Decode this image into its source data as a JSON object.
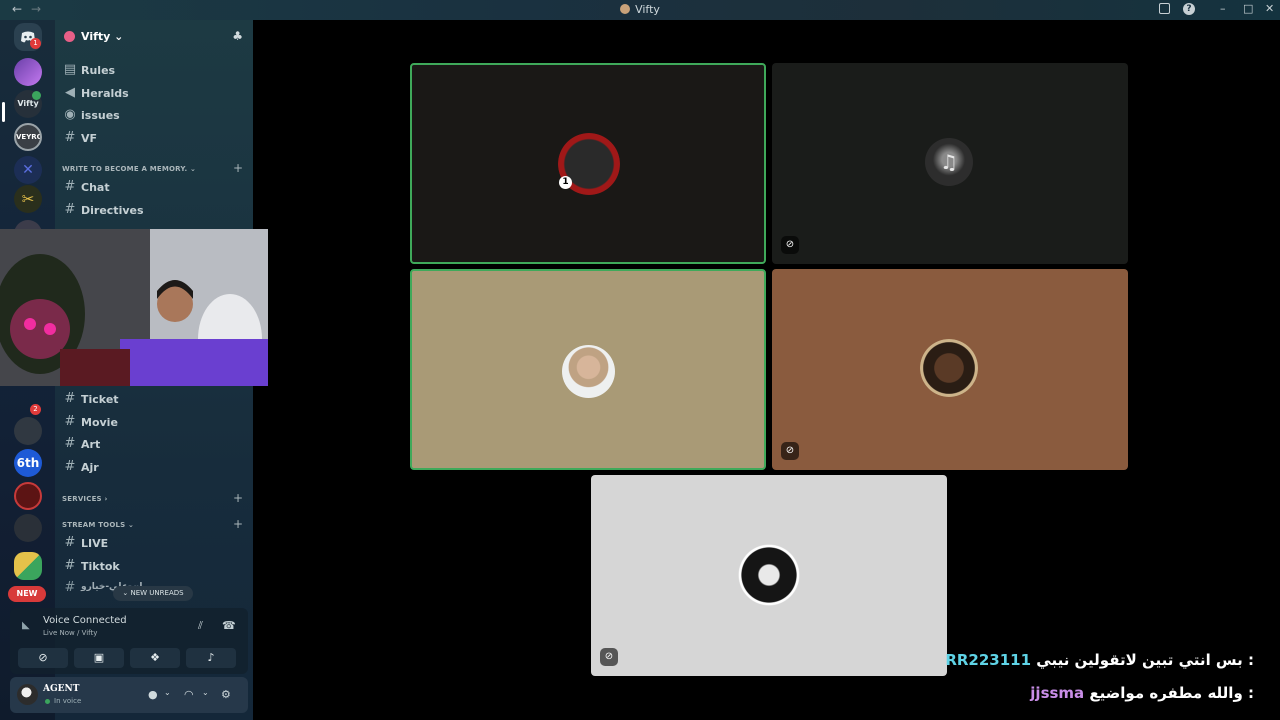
{
  "window": {
    "title": "Vifty",
    "back_glyph": "←",
    "forward_glyph": "→",
    "minimize_glyph": "–",
    "maximize_glyph": "□",
    "close_glyph": "✕",
    "inbox_icon": "inbox-icon",
    "help_glyph": "?"
  },
  "rail": {
    "home_badge": "1",
    "server_badge": "2",
    "new_label": "NEW"
  },
  "guild": {
    "name": "Vifty",
    "chevron": "⌄",
    "add_member_glyph": "♣"
  },
  "channels_top": [
    {
      "name": "Rules",
      "icon": "rules-icon",
      "glyph": "▤"
    },
    {
      "name": "Heralds",
      "icon": "announcement-icon",
      "glyph": "◀"
    },
    {
      "name": "issues",
      "icon": "forum-icon",
      "glyph": "◉"
    },
    {
      "name": "VF",
      "icon": "hash-icon",
      "glyph": "#"
    }
  ],
  "category_memory": {
    "name": "WRITE TO BECOME A MEMORY.",
    "chevron": "⌄",
    "plus": "+"
  },
  "channels_memory": [
    {
      "name": "Chat",
      "glyph": "#"
    },
    {
      "name": "Directives",
      "glyph": "#"
    }
  ],
  "channels_mid": [
    {
      "name": "Ticket",
      "glyph": "#"
    },
    {
      "name": "Movie",
      "glyph": "#"
    },
    {
      "name": "Art",
      "glyph": "#"
    },
    {
      "name": "Ajr",
      "glyph": "#"
    }
  ],
  "category_services": {
    "name": "SERVICES",
    "chevron": "›",
    "plus": "+"
  },
  "category_stream": {
    "name": "STREAM TOOLS",
    "chevron": "⌄",
    "plus": "+"
  },
  "channels_stream": [
    {
      "name": "LIVE",
      "glyph": "#"
    },
    {
      "name": "Tiktok",
      "glyph": "#"
    },
    {
      "name": "بيبان-علي-خيارو",
      "glyph": "#"
    }
  ],
  "new_unreads": "⌄ NEW UNREADS",
  "voice": {
    "title": "Voice Connected",
    "subtitle": "Live Now / Vifty",
    "signal_glyph": "◣",
    "noise_glyph": "⫽",
    "disconnect_glyph": "☎",
    "buttons": [
      {
        "name": "camera-off-button",
        "icon": "camera-off-icon",
        "glyph": "⊘"
      },
      {
        "name": "screen-share-button",
        "icon": "screen-share-icon",
        "glyph": "▣"
      },
      {
        "name": "activities-button",
        "icon": "activities-icon",
        "glyph": "❖"
      },
      {
        "name": "soundboard-button",
        "icon": "soundboard-icon",
        "glyph": "♪"
      }
    ]
  },
  "user": {
    "name": "AGENT",
    "status": "In voice",
    "mic_glyph": "●",
    "headset_glyph": "◠",
    "settings_glyph": "⚙",
    "chevron": "⌄"
  },
  "tiles": [
    {
      "avatar": "avatar-dark-red",
      "speaking": true,
      "bg": "#1a1816",
      "badge": ""
    },
    {
      "avatar": "avatar-music-note",
      "speaking": false,
      "bg": "#1a1c1a",
      "badge": "⊘"
    },
    {
      "avatar": "avatar-man-portrait",
      "speaking": true,
      "bg": "#a99a76",
      "badge": ""
    },
    {
      "avatar": "avatar-skull-pirate",
      "speaking": false,
      "bg": "#8a5b3e",
      "badge": "⊘"
    },
    {
      "avatar": "avatar-bw-portrait",
      "speaking": false,
      "bg": "#d6d6d6",
      "badge": "⊘"
    }
  ],
  "chat": [
    {
      "user": "RR223111",
      "message": "بس انتي تبين لاتقولين نيبي : ",
      "color": "#5fd3e6"
    },
    {
      "user": "jjssma",
      "message": "والله مطفره مواضيع : ",
      "color": "#c98ee8"
    }
  ],
  "colors": {
    "speaking_border": "#3fa95a",
    "badge_red": "#e03b3b"
  }
}
